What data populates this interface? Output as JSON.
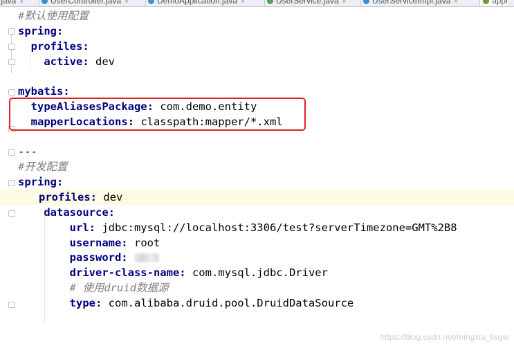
{
  "tabs": [
    {
      "label": ".java",
      "close": "×"
    },
    {
      "label": "UserController.java",
      "close": "×"
    },
    {
      "label": "DemoApplication.java",
      "close": "×"
    },
    {
      "label": "UserService.java",
      "close": "×"
    },
    {
      "label": "UserServiceImpl.java",
      "close": "×"
    },
    {
      "label": "appl",
      "active": true
    }
  ],
  "editor": {
    "lines": [
      {
        "comment": "#默认使用配置"
      },
      {
        "key": "spring:",
        "value": ""
      },
      {
        "key": "profiles:",
        "value": ""
      },
      {
        "key": "active:",
        "value": " dev"
      },
      {
        "key": "",
        "value": ""
      },
      {
        "key": "mybatis:",
        "value": ""
      },
      {
        "key": "typeAliasesPackage:",
        "value": " com.demo.entity"
      },
      {
        "key": "mapperLocations:",
        "value": " classpath:mapper/*.xml"
      },
      {
        "key": "",
        "value": ""
      },
      {
        "key": "---",
        "value": ""
      },
      {
        "comment": "#开发配置"
      },
      {
        "key": "spring:",
        "value": ""
      },
      {
        "key": "profiles:",
        "value": " dev"
      },
      {
        "key": "datasource:",
        "value": ""
      },
      {
        "key": "url:",
        "value": " jdbc:mysql://localhost:3306/test?serverTimezone=GMT%2B8"
      },
      {
        "key": "username:",
        "value": " root"
      },
      {
        "key": "password:",
        "value": ""
      },
      {
        "key": "driver-class-name:",
        "value": " com.mysql.jdbc.Driver"
      },
      {
        "comment": "# 使用druid数据源"
      },
      {
        "key": "type:",
        "value": " com.alibaba.druid.pool.DruidDataSource"
      }
    ]
  },
  "watermark": "https://blog.csdn.net/mingxia_lisgw",
  "colors": {
    "key": "#000080",
    "comment": "#808080",
    "highlight_line": "#fffae3",
    "annotation_box": "#e02020"
  }
}
